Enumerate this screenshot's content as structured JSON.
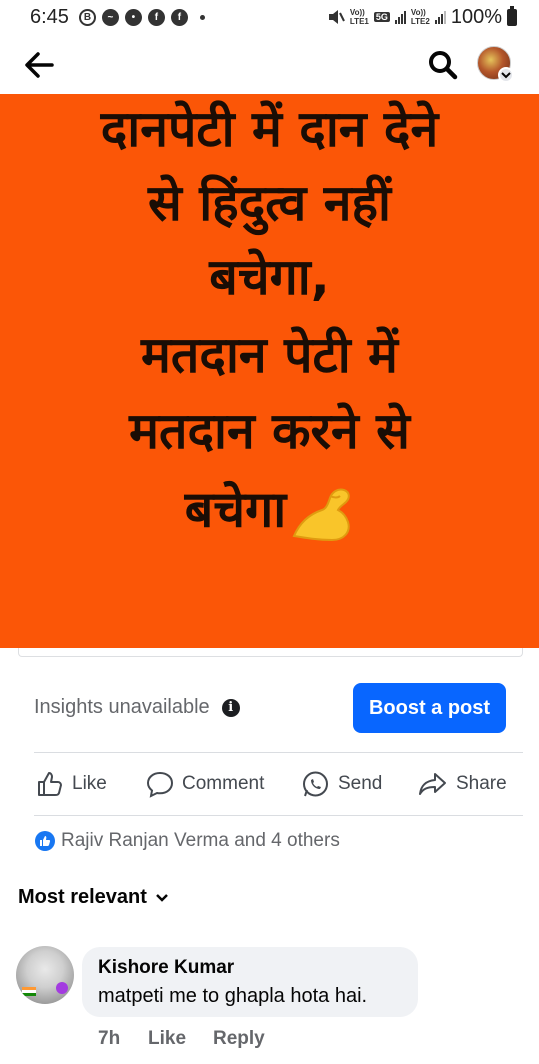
{
  "status_bar": {
    "time": "6:45",
    "battery": "100%",
    "net1_top": "Vo))",
    "net1_bottom": "LTE1",
    "net_5g": "5G",
    "net2_top": "Vo))",
    "net2_bottom": "LTE2"
  },
  "post": {
    "image_lines": [
      "दानपेटी में दान देने",
      "से हिंदुत्व नहीं",
      "बचेगा,",
      "मतदान पेटी में",
      "मतदान करने से",
      "बचेगा"
    ],
    "image_bg": "#fb5607"
  },
  "insights": {
    "label": "Insights unavailable",
    "boost_label": "Boost a post"
  },
  "actions": {
    "like": "Like",
    "comment": "Comment",
    "send": "Send",
    "share": "Share"
  },
  "reactions": {
    "summary": "Rajiv Ranjan Verma and 4 others"
  },
  "sort": {
    "label": "Most relevant"
  },
  "comment": {
    "author": "Kishore Kumar",
    "text": "matpeti me to ghapla hota hai.",
    "time": "7h",
    "like": "Like",
    "reply": "Reply"
  },
  "colors": {
    "accent": "#0866ff",
    "like_badge": "#1877f2"
  }
}
